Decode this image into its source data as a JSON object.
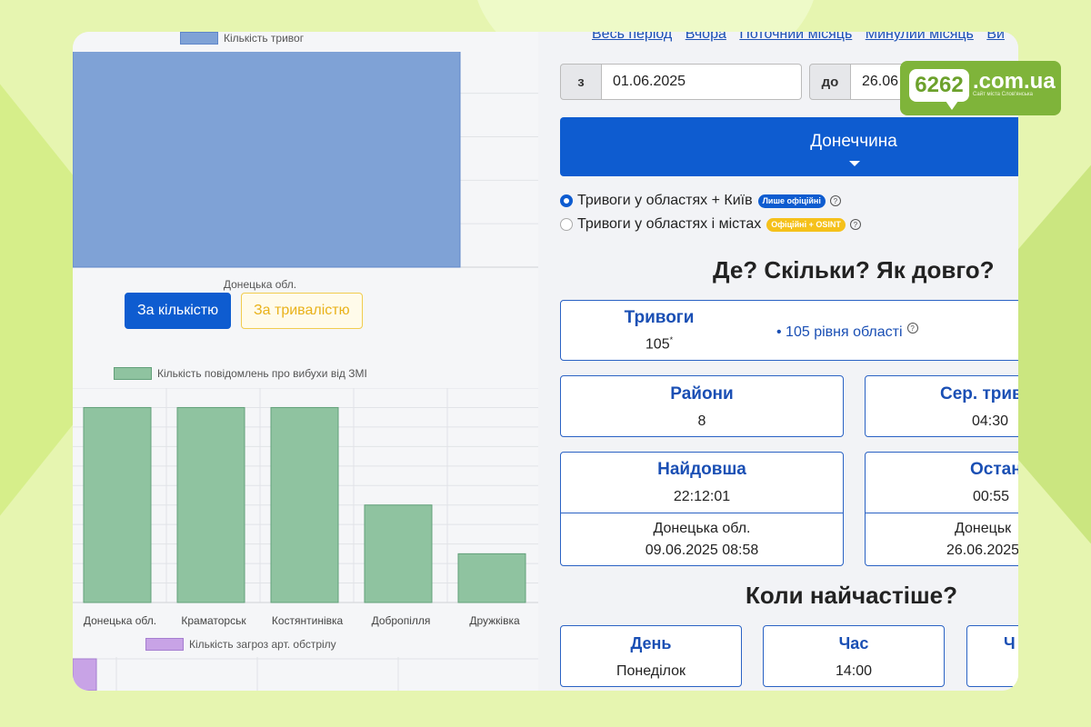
{
  "colors": {
    "primary": "#0e5cd0",
    "bar_count": "#7fa2d6",
    "bar_media": "#8fc3a0",
    "bar_artillery": "#c8a3e6",
    "logo_green": "#7fb43a"
  },
  "left": {
    "legend_alerts": "Кількість тривог",
    "legend_media": "Кількість повідомлень про вибухи від ЗМІ",
    "legend_artillery": "Кількість загроз арт. обстрілу",
    "toggle_count": "За кількістю",
    "toggle_duration": "За тривалістю"
  },
  "chart_data": [
    {
      "type": "bar",
      "series": [
        {
          "name": "Кількість тривог",
          "values": [
            105
          ]
        }
      ],
      "categories": [
        "Донецька обл."
      ],
      "ylim": [
        0,
        120
      ],
      "grid": true,
      "legend": "top"
    },
    {
      "type": "bar",
      "series": [
        {
          "name": "Кількість повідомлень про вибухи від ЗМІ",
          "values": [
            10,
            10,
            10,
            5,
            2.5
          ]
        }
      ],
      "categories": [
        "Донецька обл.",
        "Краматорськ",
        "Костянтинівка",
        "Добропілля",
        "Дружківка"
      ],
      "ylim": [
        0,
        11
      ],
      "grid": true,
      "legend": "top"
    },
    {
      "type": "bar",
      "series": [
        {
          "name": "Кількість загроз арт. обстрілу",
          "values": []
        }
      ],
      "categories": [],
      "grid": true,
      "legend": "top"
    }
  ],
  "right": {
    "period_links": [
      "Весь період",
      "Вчора",
      "Поточний місяць",
      "Минулий місяць",
      "Ви"
    ],
    "date_from_label": "з",
    "date_from_value": "01.06.2025",
    "date_to_label": "до",
    "date_to_value": "26.06",
    "region": "Донеччина",
    "radio_1": "Тривоги у областях + Київ",
    "badge_1": "Лише офіційні",
    "radio_2": "Тривоги у областях і містах",
    "badge_2": "Офіційні + OSINT",
    "help_glyph": "?",
    "section_where": "Де? Скільки? Як довго?",
    "alerts_title": "Тривоги",
    "alerts_value": "105",
    "alerts_sup": "*",
    "alerts_note": "• 105 рівня області",
    "districts_title": "Райони",
    "districts_value": "8",
    "avg_title": "Сер. трив",
    "avg_value": "04:30",
    "longest_title": "Найдовша",
    "longest_duration": "22:12:01",
    "longest_region": "Донецька обл.",
    "longest_date": "09.06.2025 08:58",
    "last_title": "Остан",
    "last_duration": "00:55",
    "last_region": "Донецьк",
    "last_date": "26.06.2025",
    "section_when": "Коли найчастіше?",
    "day_title": "День",
    "day_value": "Понеділок",
    "hour_title": "Час",
    "hour_value": "14:00",
    "freq_title": "Ч"
  },
  "logo": {
    "number": "6262",
    "domain": ".com.ua",
    "tagline": "Сайт міста Слов'янська"
  }
}
